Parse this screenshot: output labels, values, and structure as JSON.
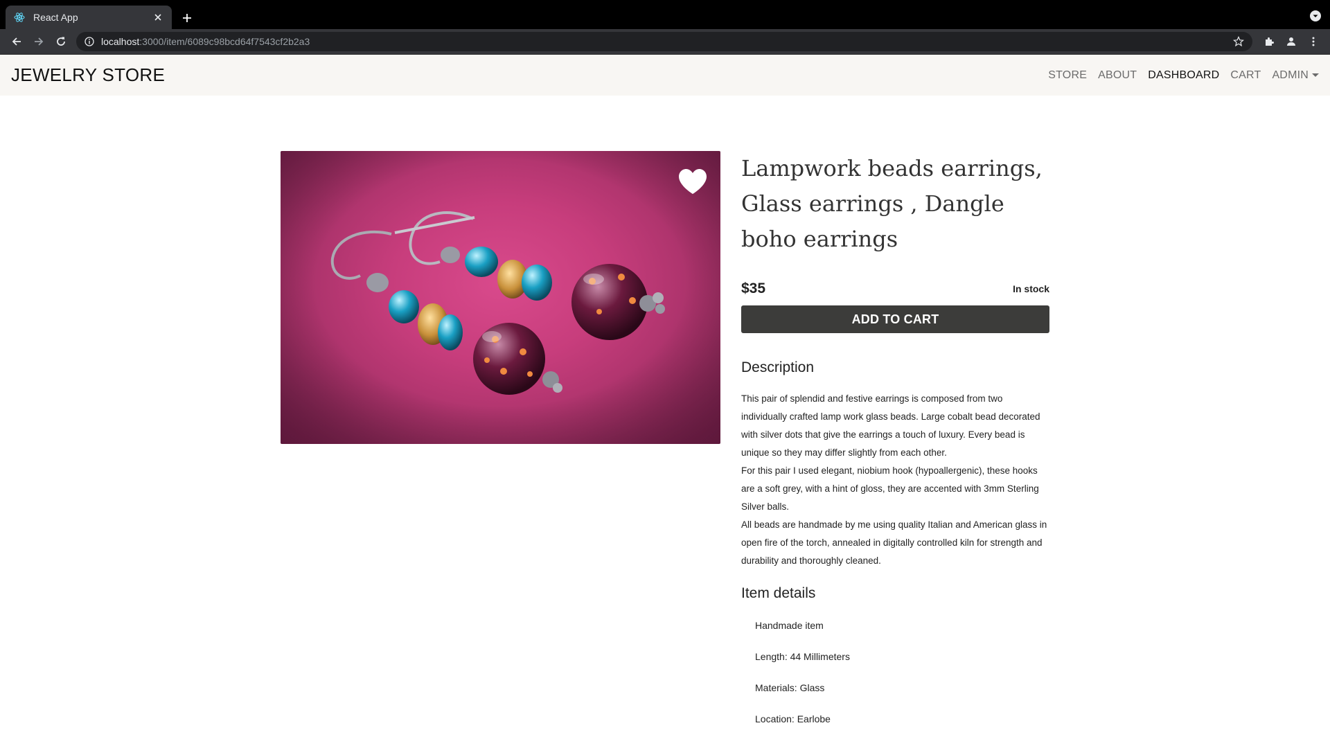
{
  "browser": {
    "tab_title": "React App",
    "url_host": "localhost",
    "url_path": ":3000/item/6089c98bcd64f7543cf2b2a3"
  },
  "navbar": {
    "brand": "JEWELRY STORE",
    "links": [
      "STORE",
      "ABOUT",
      "DASHBOARD",
      "CART",
      "ADMIN"
    ],
    "active": "DASHBOARD"
  },
  "product": {
    "title": "Lampwork beads earrings, Glass earrings , Dangle boho earrings",
    "price": "$35",
    "stock": "In stock",
    "add_to_cart": "ADD TO CART",
    "description_heading": "Description",
    "description": [
      "This pair of splendid and festive earrings is composed from two individually crafted lamp work glass beads. Large cobalt bead decorated with silver dots that give the earrings a touch of luxury. Every bead is unique so they may differ slightly from each other.",
      "For this pair I used elegant, niobium hook (hypoallergenic), these hooks are a soft grey, with a hint of gloss, they are accented with 3mm Sterling Silver balls.",
      "All beads are handmade by me using quality Italian and American glass in open fire of the torch, annealed in digitally controlled kiln for strength and durability and thoroughly cleaned."
    ],
    "details_heading": "Item details",
    "details": [
      "Handmade item",
      "Length: 44 Millimeters",
      "Materials: Glass",
      "Location: Earlobe"
    ]
  },
  "colors": {
    "navbar_bg": "#f8f6f3",
    "button_bg": "#3c3c3a",
    "photo_bg": "#c73d7c"
  },
  "icons": [
    "react-icon",
    "close-icon",
    "plus-icon",
    "back-icon",
    "forward-icon",
    "reload-icon",
    "info-icon",
    "star-icon",
    "extensions-icon",
    "profile-icon",
    "menu-icon",
    "heart-icon"
  ]
}
